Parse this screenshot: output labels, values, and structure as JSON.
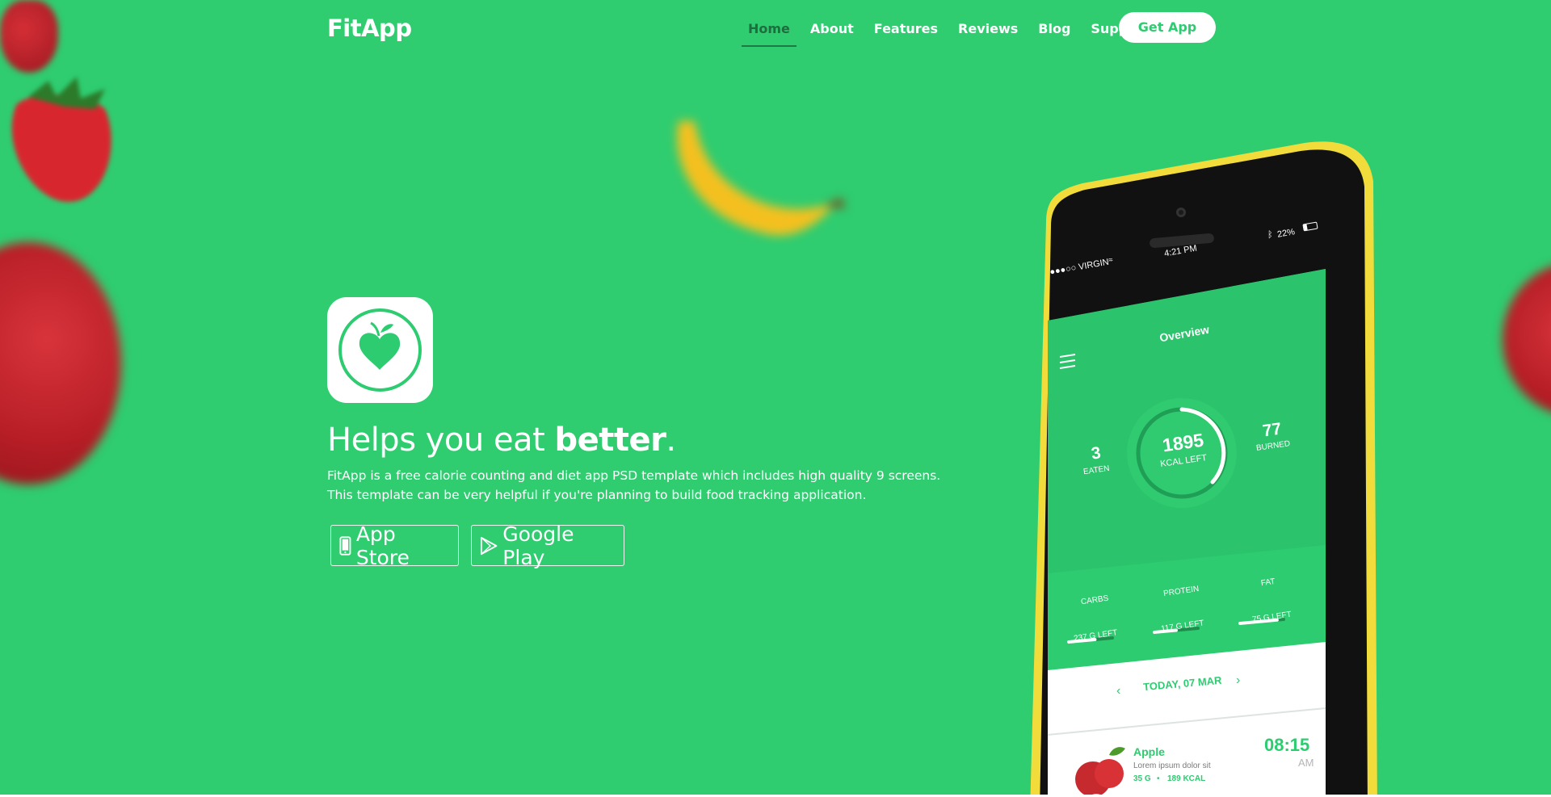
{
  "nav": {
    "brand": "FitApp",
    "items": [
      {
        "label": "Home",
        "active": true
      },
      {
        "label": "About",
        "active": false
      },
      {
        "label": "Features",
        "active": false
      },
      {
        "label": "Reviews",
        "active": false
      },
      {
        "label": "Blog",
        "active": false
      },
      {
        "label": "Support",
        "active": false
      }
    ],
    "cta": "Get App"
  },
  "hero": {
    "headline_light": "Helps you eat ",
    "headline_bold": "better",
    "headline_end": ".",
    "description": "FitApp is a free calorie counting and diet app PSD template which includes high quality 9 screens. This template can be very helpful if you're planning to build food tracking application.",
    "buttons": {
      "app_store": "App Store",
      "google_play": "Google Play"
    }
  },
  "phone": {
    "status": {
      "carrier": "●●●○○ VIRGIN",
      "time": "4:21 PM",
      "battery": "22%"
    },
    "title": "Overview",
    "eaten": {
      "value": "3",
      "label": "EATEN"
    },
    "kcal": {
      "value": "1895",
      "label": "KCAL LEFT"
    },
    "burned": {
      "value": "77",
      "label": "BURNED"
    },
    "macros": [
      {
        "name": "CARBS",
        "left": "237 G LEFT",
        "fill": 0.6
      },
      {
        "name": "PROTEIN",
        "left": "117 G LEFT",
        "fill": 0.5
      },
      {
        "name": "FAT",
        "left": "75 G LEFT",
        "fill": 0.85
      }
    ],
    "date": "TODAY, 07 MAR",
    "entry": {
      "name": "Apple",
      "desc": "Lorem ipsum dolor sit",
      "grams": "35 G",
      "kcal": "189 KCAL",
      "time": "08:15",
      "ampm": "AM"
    }
  },
  "colors": {
    "background": "#2fcd70",
    "accent_dark": "#1d6e3f",
    "phone_shell": "#f4e04d",
    "screen_green": "#2ecc71"
  }
}
